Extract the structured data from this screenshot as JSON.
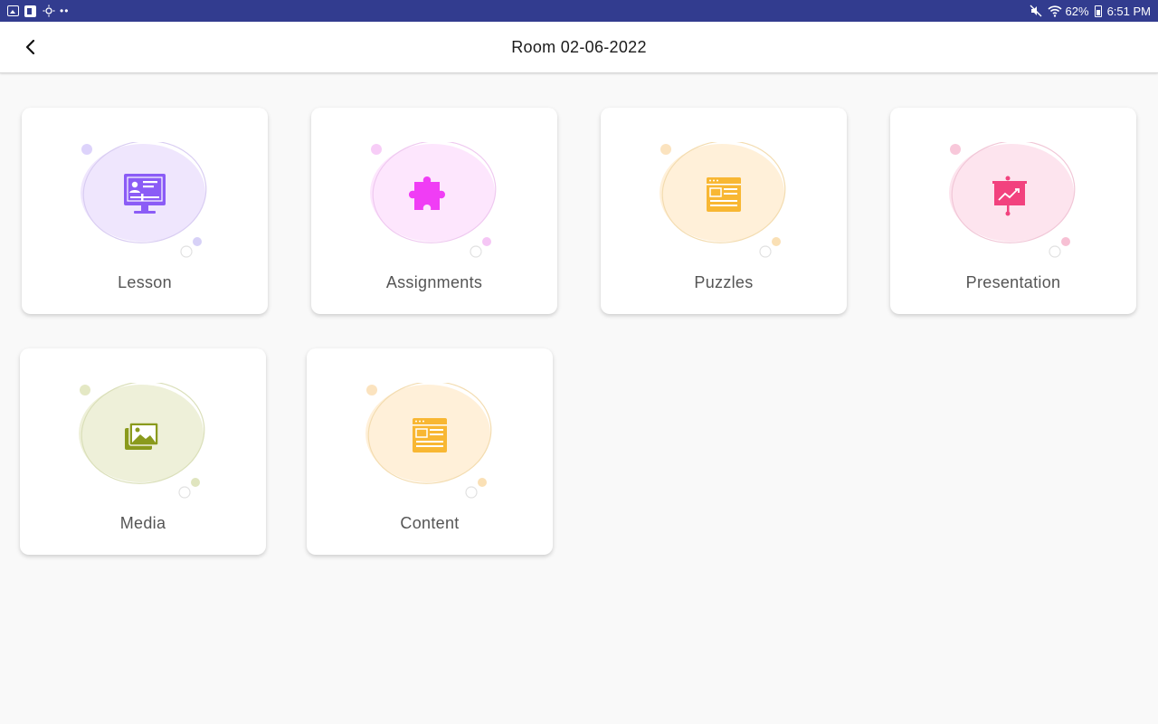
{
  "status_bar": {
    "battery": "62%",
    "time": "6:51 PM",
    "background": "#323c8f"
  },
  "app_bar": {
    "title": "Room 02-06-2022",
    "back_icon": "chevron-left-icon"
  },
  "cards": [
    {
      "label": "Lesson",
      "icon": "monitor-presentation-icon",
      "accent": "#8b5cf6",
      "bubble": "#efe6fd"
    },
    {
      "label": "Assignments",
      "icon": "puzzle-icon",
      "accent": "#f03df5",
      "bubble": "#fde6fd"
    },
    {
      "label": "Puzzles",
      "icon": "browser-window-icon",
      "accent": "#f8b733",
      "bubble": "#fff0d9"
    },
    {
      "label": "Presentation",
      "icon": "chart-board-icon",
      "accent": "#f2427e",
      "bubble": "#fde4ee"
    },
    {
      "label": "Media",
      "icon": "image-gallery-icon",
      "accent": "#8a9a1d",
      "bubble": "#eef0d9"
    },
    {
      "label": "Content",
      "icon": "browser-window-icon",
      "accent": "#f8b733",
      "bubble": "#fff0d9"
    }
  ]
}
